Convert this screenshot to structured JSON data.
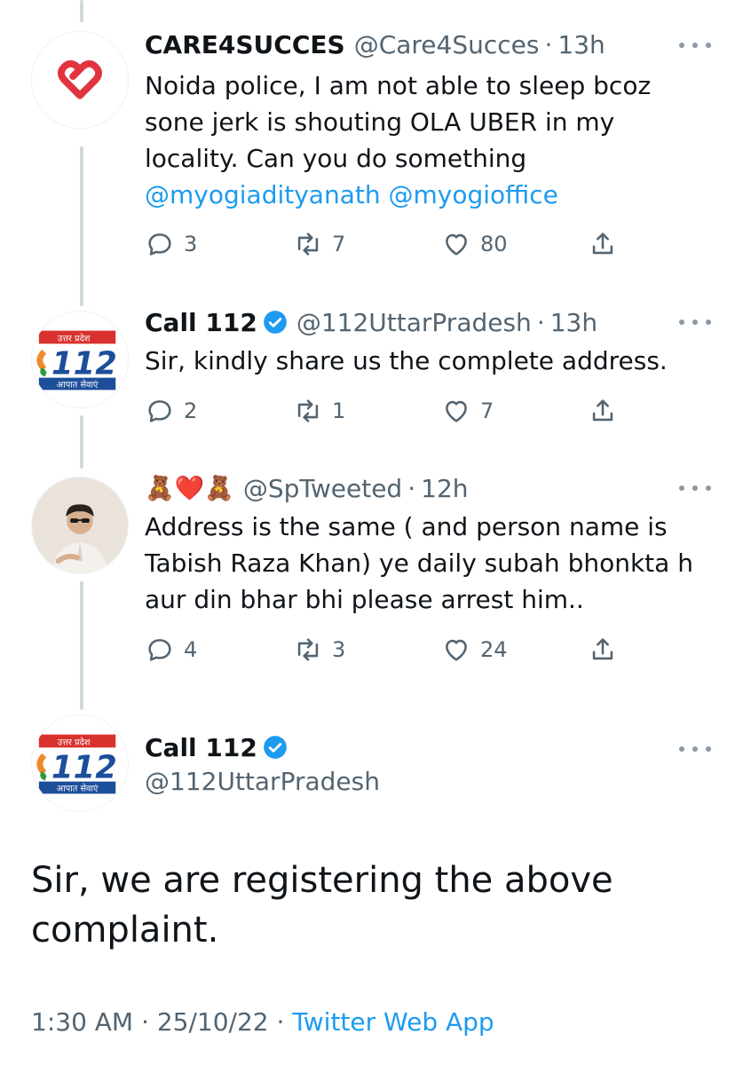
{
  "tweets": [
    {
      "name": "CARE4SUCCES",
      "handle": "@Care4Succes",
      "separator": "·",
      "time": "13h",
      "lines": [
        "Noida police, I am not able to sleep bcoz",
        "sone jerk is shouting OLA UBER in my",
        "locality. Can you do something"
      ],
      "mentions": [
        "@myogiadityanath",
        "@myogioffice"
      ],
      "counts": {
        "replies": "3",
        "retweets": "7",
        "likes": "80"
      },
      "avatar_icon": "heart-logo-icon"
    },
    {
      "name": "Call 112",
      "handle": "@112UttarPradesh",
      "separator": "·",
      "time": "13h",
      "lines": [
        "Sir, kindly share us the complete address."
      ],
      "counts": {
        "replies": "2",
        "retweets": "1",
        "likes": "7"
      },
      "avatar_icon": "call-112-logo-icon"
    },
    {
      "name": "🧸❤️🧸",
      "handle": "@SpTweeted",
      "separator": "·",
      "time": "12h",
      "lines": [
        "Address is the same ( and person name is",
        "Tabish Raza Khan) ye daily subah bhonkta h",
        "aur din bhar bhi please arrest him.."
      ],
      "counts": {
        "replies": "4",
        "retweets": "3",
        "likes": "24"
      },
      "avatar_icon": "person-photo-icon"
    }
  ],
  "main_tweet": {
    "name": "Call 112",
    "handle": "@112UttarPradesh",
    "lines": [
      "Sir, we are registering the above",
      "complaint."
    ],
    "time": "1:30 AM",
    "separator": "·",
    "date": "25/10/22",
    "app": "Twitter Web App"
  },
  "logo_112": {
    "top_text": "उत्तर प्रदेश",
    "number": "112",
    "bottom_text": "आपात सेवाएं"
  },
  "colors": {
    "accent": "#1d9bf0",
    "secondary_text": "#536471",
    "text": "#0f1419",
    "thread_line": "#cfd9de"
  }
}
